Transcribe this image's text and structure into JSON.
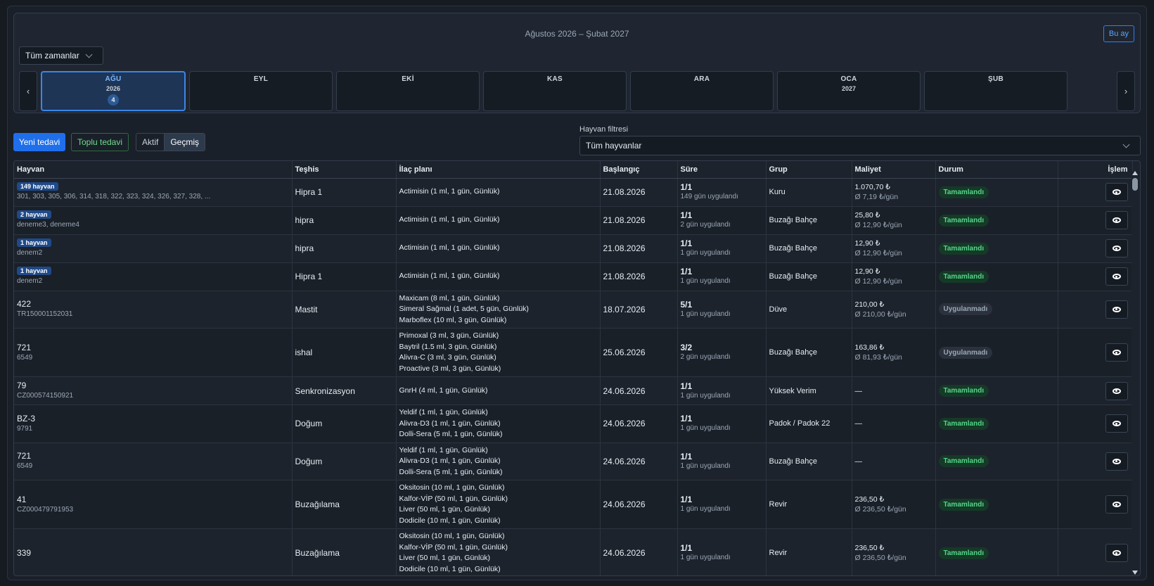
{
  "header": {
    "period_title": "Ağustos 2026 – Şubat 2027",
    "this_month_label": "Bu ay",
    "time_range_value": "Tüm zamanlar",
    "prev_label": "‹",
    "next_label": "›"
  },
  "months": [
    {
      "name": "AĞU",
      "year": "2026",
      "count": "4",
      "active": true
    },
    {
      "name": "EYL",
      "year": "",
      "count": "",
      "active": false
    },
    {
      "name": "EKİ",
      "year": "",
      "count": "",
      "active": false
    },
    {
      "name": "KAS",
      "year": "",
      "count": "",
      "active": false
    },
    {
      "name": "ARA",
      "year": "",
      "count": "",
      "active": false
    },
    {
      "name": "OCA",
      "year": "2027",
      "count": "",
      "active": false
    },
    {
      "name": "ŞUB",
      "year": "",
      "count": "",
      "active": false
    }
  ],
  "toolbar": {
    "new_label": "Yeni tedavi",
    "bulk_label": "Toplu tedavi",
    "active_label": "Aktif",
    "past_label": "Geçmiş",
    "filter_label": "Hayvan filtresi",
    "filter_value": "Tüm hayvanlar"
  },
  "table": {
    "columns": [
      "Hayvan",
      "Teşhis",
      "İlaç planı",
      "Başlangıç",
      "Süre",
      "Grup",
      "Maliyet",
      "Durum",
      "İşlem"
    ],
    "rows": [
      {
        "badge": "149 hayvan",
        "animal": "",
        "sub": "301, 303, 305, 306, 314, 318, 322, 323, 324, 326, 327, 328, ...",
        "diagnosis": "Hipra 1",
        "drugs": [
          "Actimisin (1 ml, 1 gün, Günlük)"
        ],
        "start": "21.08.2026",
        "duration": "1/1",
        "applied": "149 gün uygulandı",
        "group": "Kuru",
        "cost": "1.070,70 ₺",
        "cost_daily": "Ø 7,19 ₺/gün",
        "status": "Tamamlandı",
        "done": true
      },
      {
        "badge": "2 hayvan",
        "animal": "",
        "sub": "deneme3, deneme4",
        "diagnosis": "hipra",
        "drugs": [
          "Actimisin (1 ml, 1 gün, Günlük)"
        ],
        "start": "21.08.2026",
        "duration": "1/1",
        "applied": "2 gün uygulandı",
        "group": "Buzağı Bahçe",
        "cost": "25,80 ₺",
        "cost_daily": "Ø 12,90 ₺/gün",
        "status": "Tamamlandı",
        "done": true
      },
      {
        "badge": "1 hayvan",
        "animal": "",
        "sub": "denem2",
        "diagnosis": "hipra",
        "drugs": [
          "Actimisin (1 ml, 1 gün, Günlük)"
        ],
        "start": "21.08.2026",
        "duration": "1/1",
        "applied": "1 gün uygulandı",
        "group": "Buzağı Bahçe",
        "cost": "12,90 ₺",
        "cost_daily": "Ø 12,90 ₺/gün",
        "status": "Tamamlandı",
        "done": true
      },
      {
        "badge": "1 hayvan",
        "animal": "",
        "sub": "denem2",
        "diagnosis": "Hipra 1",
        "drugs": [
          "Actimisin (1 ml, 1 gün, Günlük)"
        ],
        "start": "21.08.2026",
        "duration": "1/1",
        "applied": "1 gün uygulandı",
        "group": "Buzağı Bahçe",
        "cost": "12,90 ₺",
        "cost_daily": "Ø 12,90 ₺/gün",
        "status": "Tamamlandı",
        "done": true
      },
      {
        "badge": "",
        "animal": "422",
        "sub": "TR150001152031",
        "diagnosis": "Mastit",
        "drugs": [
          "Maxicam (8 ml, 1 gün, Günlük)",
          "Simeral Sağmal (1 adet, 5 gün, Günlük)",
          "Marboflex (10 ml, 3 gün, Günlük)"
        ],
        "start": "18.07.2026",
        "duration": "5/1",
        "applied": "1 gün uygulandı",
        "group": "Düve",
        "cost": "210,00 ₺",
        "cost_daily": "Ø 210,00 ₺/gün",
        "status": "Uygulanmadı",
        "done": false
      },
      {
        "badge": "",
        "animal": "721",
        "sub": "6549",
        "diagnosis": "ishal",
        "drugs": [
          "Primoxal (3 ml, 3 gün, Günlük)",
          "Baytril (1.5 ml, 3 gün, Günlük)",
          "Alivra-C (3 ml, 3 gün, Günlük)",
          "Proactive (3 ml, 3 gün, Günlük)"
        ],
        "start": "25.06.2026",
        "duration": "3/2",
        "applied": "2 gün uygulandı",
        "group": "Buzağı Bahçe",
        "cost": "163,86 ₺",
        "cost_daily": "Ø 81,93 ₺/gün",
        "status": "Uygulanmadı",
        "done": false
      },
      {
        "badge": "",
        "animal": "79",
        "sub": "CZ000574150921",
        "diagnosis": "Senkronizasyon",
        "drugs": [
          "GnrH (4 ml, 1 gün, Günlük)"
        ],
        "start": "24.06.2026",
        "duration": "1/1",
        "applied": "1 gün uygulandı",
        "group": "Yüksek Verim",
        "cost": "—",
        "cost_daily": "",
        "status": "Tamamlandı",
        "done": true
      },
      {
        "badge": "",
        "animal": "BZ-3",
        "sub": "9791",
        "diagnosis": "Doğum",
        "drugs": [
          "Yeldif (1 ml, 1 gün, Günlük)",
          "Alivra-D3 (1 ml, 1 gün, Günlük)",
          "Dolli-Sera (5 ml, 1 gün, Günlük)"
        ],
        "start": "24.06.2026",
        "duration": "1/1",
        "applied": "1 gün uygulandı",
        "group": "Padok / Padok 22",
        "cost": "—",
        "cost_daily": "",
        "status": "Tamamlandı",
        "done": true
      },
      {
        "badge": "",
        "animal": "721",
        "sub": "6549",
        "diagnosis": "Doğum",
        "drugs": [
          "Yeldif (1 ml, 1 gün, Günlük)",
          "Alivra-D3 (1 ml, 1 gün, Günlük)",
          "Dolli-Sera (5 ml, 1 gün, Günlük)"
        ],
        "start": "24.06.2026",
        "duration": "1/1",
        "applied": "1 gün uygulandı",
        "group": "Buzağı Bahçe",
        "cost": "—",
        "cost_daily": "",
        "status": "Tamamlandı",
        "done": true
      },
      {
        "badge": "",
        "animal": "41",
        "sub": "CZ000479791953",
        "diagnosis": "Buzağılama",
        "drugs": [
          "Oksitosin (10 ml, 1 gün, Günlük)",
          "Kalfor-VİP (50 ml, 1 gün, Günlük)",
          "Liver (50 ml, 1 gün, Günlük)",
          "Dodicile (10 ml, 1 gün, Günlük)"
        ],
        "start": "24.06.2026",
        "duration": "1/1",
        "applied": "1 gün uygulandı",
        "group": "Revir",
        "cost": "236,50 ₺",
        "cost_daily": "Ø 236,50 ₺/gün",
        "status": "Tamamlandı",
        "done": true
      },
      {
        "badge": "",
        "animal": "339",
        "sub": "",
        "diagnosis": "Buzağılama",
        "drugs": [
          "Oksitosin (10 ml, 1 gün, Günlük)",
          "Kalfor-VİP (50 ml, 1 gün, Günlük)",
          "Liver (50 ml, 1 gün, Günlük)",
          "Dodicile (10 ml, 1 gün, Günlük)"
        ],
        "start": "24.06.2026",
        "duration": "1/1",
        "applied": "1 gün uygulandı",
        "group": "Revir",
        "cost": "236,50 ₺",
        "cost_daily": "Ø 236,50 ₺/gün",
        "status": "Tamamlandı",
        "done": true
      }
    ]
  },
  "colors": {
    "primary": "#1f6feb",
    "success": "#55d68a",
    "background": "#1a2029"
  }
}
